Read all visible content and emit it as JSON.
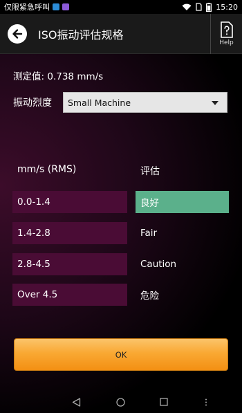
{
  "status_bar": {
    "carrier_text": "仅限紧急呼叫",
    "time": "15:20",
    "app_icon_colors": [
      "#2b8bd6",
      "#8c5ad8"
    ]
  },
  "title_bar": {
    "title": "ISO振动评估规格",
    "help_label": "Help"
  },
  "measured": {
    "label": "测定值:",
    "value": "0.738",
    "unit": "mm/s"
  },
  "severity": {
    "label": "振动烈度",
    "selected": "Small Machine"
  },
  "table": {
    "range_header": "mm/s (RMS)",
    "rating_header": "评估",
    "rows": [
      {
        "range": "0.0-1.4",
        "rating": "良好",
        "active": true
      },
      {
        "range": "1.4-2.8",
        "rating": "Fair",
        "active": false
      },
      {
        "range": "2.8-4.5",
        "rating": "Caution",
        "active": false
      },
      {
        "range": "Over 4.5",
        "rating": "危险",
        "active": false
      }
    ]
  },
  "ok_label": "OK",
  "colors": {
    "active_rating": "#5bb08b",
    "range_cell": "#4a0c35",
    "ok_button": "#f9a833"
  },
  "icons": [
    "back-arrow-icon",
    "help-icon",
    "wifi-icon",
    "sim-icon",
    "battery-icon",
    "nav-back-icon",
    "nav-home-icon",
    "nav-recents-icon",
    "nav-menu-icon"
  ]
}
